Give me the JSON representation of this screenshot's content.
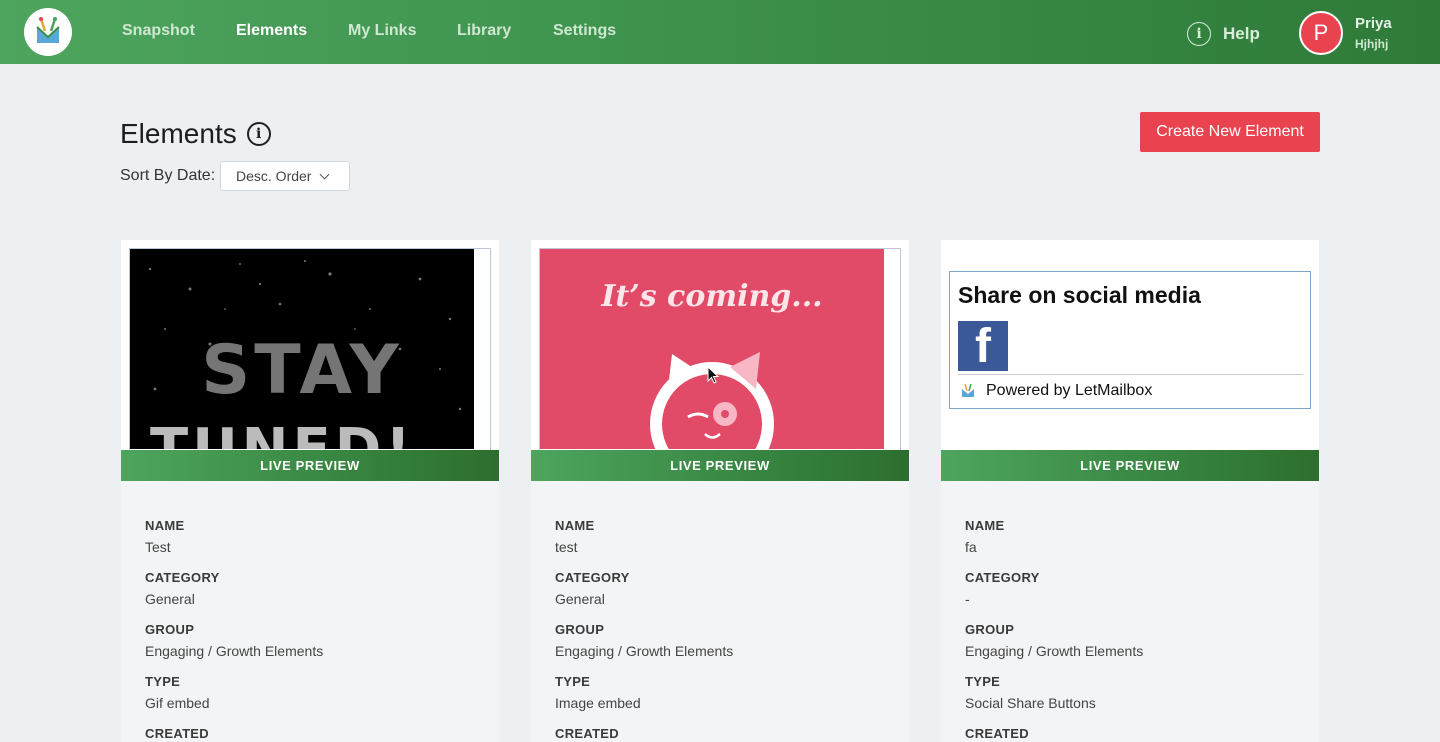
{
  "nav": {
    "items": [
      {
        "label": "Snapshot",
        "active": false
      },
      {
        "label": "Elements",
        "active": true
      },
      {
        "label": "My Links",
        "active": false
      },
      {
        "label": "Library",
        "active": false
      },
      {
        "label": "Settings",
        "active": false
      }
    ],
    "help_label": "Help",
    "user": {
      "initial": "P",
      "name": "Priya",
      "subtitle": "Hjhjhj"
    }
  },
  "page": {
    "title": "Elements",
    "sort_label": "Sort By Date:",
    "sort_value": "Desc. Order",
    "create_button": "Create New Element"
  },
  "cards": [
    {
      "preview_kind": "gif",
      "preview_text_1": "STAY",
      "preview_text_2": "TUNED!",
      "live_preview": "LIVE PREVIEW",
      "fields": [
        {
          "label": "NAME",
          "value": "Test"
        },
        {
          "label": "CATEGORY",
          "value": "General"
        },
        {
          "label": "GROUP",
          "value": "Engaging / Growth Elements"
        },
        {
          "label": "TYPE",
          "value": "Gif embed"
        },
        {
          "label": "CREATED",
          "value": ""
        }
      ]
    },
    {
      "preview_kind": "image",
      "preview_text_1": "It’s coming...",
      "live_preview": "LIVE PREVIEW",
      "fields": [
        {
          "label": "NAME",
          "value": "test"
        },
        {
          "label": "CATEGORY",
          "value": "General"
        },
        {
          "label": "GROUP",
          "value": "Engaging / Growth Elements"
        },
        {
          "label": "TYPE",
          "value": "Image embed"
        },
        {
          "label": "CREATED",
          "value": ""
        }
      ]
    },
    {
      "preview_kind": "social",
      "social_title": "Share on social media",
      "fb_glyph": "f",
      "powered_by": "Powered by LetMailbox",
      "live_preview": "LIVE PREVIEW",
      "fields": [
        {
          "label": "NAME",
          "value": "fa"
        },
        {
          "label": "CATEGORY",
          "value": "-"
        },
        {
          "label": "GROUP",
          "value": "Engaging / Growth Elements"
        },
        {
          "label": "TYPE",
          "value": "Social Share Buttons"
        },
        {
          "label": "CREATED",
          "value": ""
        }
      ]
    }
  ],
  "colors": {
    "brand_green": "#3f944f",
    "accent_red": "#e8434f",
    "facebook_blue": "#3b5998",
    "page_bg": "#edf0f2"
  }
}
